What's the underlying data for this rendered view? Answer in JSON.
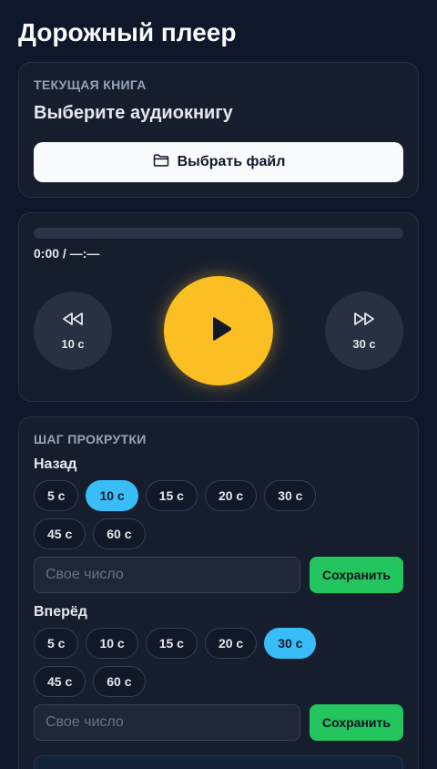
{
  "app": {
    "title": "Дорожный плеер"
  },
  "book": {
    "section_label": "Текущая книга",
    "title": "Выберите аудиокнигу",
    "file_button_label": "Выбрать файл",
    "file_button_icon": "folder-icon"
  },
  "player": {
    "time_readout": "0:00 / —:—",
    "progress": 0,
    "rewind": {
      "label": "10 с",
      "icon": "rewind-icon"
    },
    "play": {
      "icon": "play-icon"
    },
    "forward": {
      "label": "30 с",
      "icon": "fast-forward-icon"
    },
    "colors": {
      "play": "#fbbf24"
    }
  },
  "steps": {
    "section_label": "Шаг прокрутки",
    "back": {
      "label": "Назад",
      "options": [
        "5 с",
        "10 с",
        "15 с",
        "20 с",
        "30 с",
        "45 с",
        "60 с"
      ],
      "selected": "10 с",
      "custom_placeholder": "Свое число",
      "save_label": "Сохранить"
    },
    "forward": {
      "label": "Вперёд",
      "options": [
        "5 с",
        "10 с",
        "15 с",
        "20 с",
        "30 с",
        "45 с",
        "60 с"
      ],
      "selected": "30 с",
      "custom_placeholder": "Свое число",
      "save_label": "Сохранить"
    },
    "colors": {
      "active_chip": "#38bdf8",
      "save": "#22c55e"
    }
  }
}
